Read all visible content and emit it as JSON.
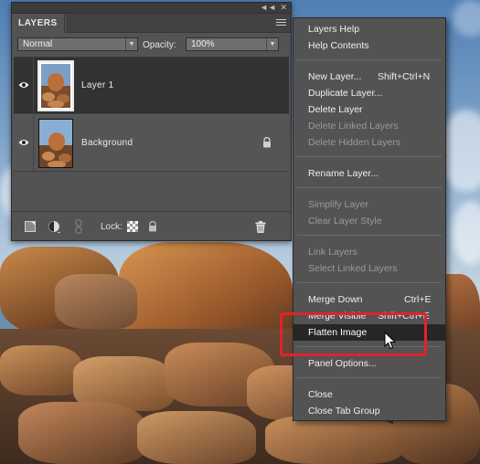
{
  "panel": {
    "tab_label": "LAYERS",
    "blend_mode": "Normal",
    "opacity_label": "Opacity:",
    "opacity_value": "100%",
    "layers": [
      {
        "name": "Layer 1",
        "selected": true,
        "locked": false
      },
      {
        "name": "Background",
        "selected": false,
        "locked": true
      }
    ],
    "lock_label": "Lock:"
  },
  "context_menu": {
    "items": [
      {
        "label": "Layers Help",
        "shortcut": "",
        "disabled": false
      },
      {
        "label": "Help Contents",
        "shortcut": "",
        "disabled": false
      },
      {
        "label": "New Layer...",
        "shortcut": "Shift+Ctrl+N",
        "disabled": false
      },
      {
        "label": "Duplicate Layer...",
        "shortcut": "",
        "disabled": false
      },
      {
        "label": "Delete Layer",
        "shortcut": "",
        "disabled": false
      },
      {
        "label": "Delete Linked Layers",
        "shortcut": "",
        "disabled": true
      },
      {
        "label": "Delete Hidden Layers",
        "shortcut": "",
        "disabled": true
      },
      {
        "label": "Rename Layer...",
        "shortcut": "",
        "disabled": false
      },
      {
        "label": "Simplify Layer",
        "shortcut": "",
        "disabled": true
      },
      {
        "label": "Clear Layer Style",
        "shortcut": "",
        "disabled": true
      },
      {
        "label": "Link Layers",
        "shortcut": "",
        "disabled": true
      },
      {
        "label": "Select Linked Layers",
        "shortcut": "",
        "disabled": true
      },
      {
        "label": "Merge Down",
        "shortcut": "Ctrl+E",
        "disabled": false
      },
      {
        "label": "Merge Visible",
        "shortcut": "Shift+Ctrl+E",
        "disabled": false
      },
      {
        "label": "Flatten Image",
        "shortcut": "",
        "disabled": false,
        "highlighted": true
      },
      {
        "label": "Panel Options...",
        "shortcut": "",
        "disabled": false
      },
      {
        "label": "Close",
        "shortcut": "",
        "disabled": false
      },
      {
        "label": "Close Tab Group",
        "shortcut": "",
        "disabled": false
      }
    ]
  },
  "colors": {
    "panel_bg": "#535353",
    "menu_highlight": "#262626",
    "callout_red": "#e0232b",
    "disabled_text": "#9a9a9a"
  }
}
